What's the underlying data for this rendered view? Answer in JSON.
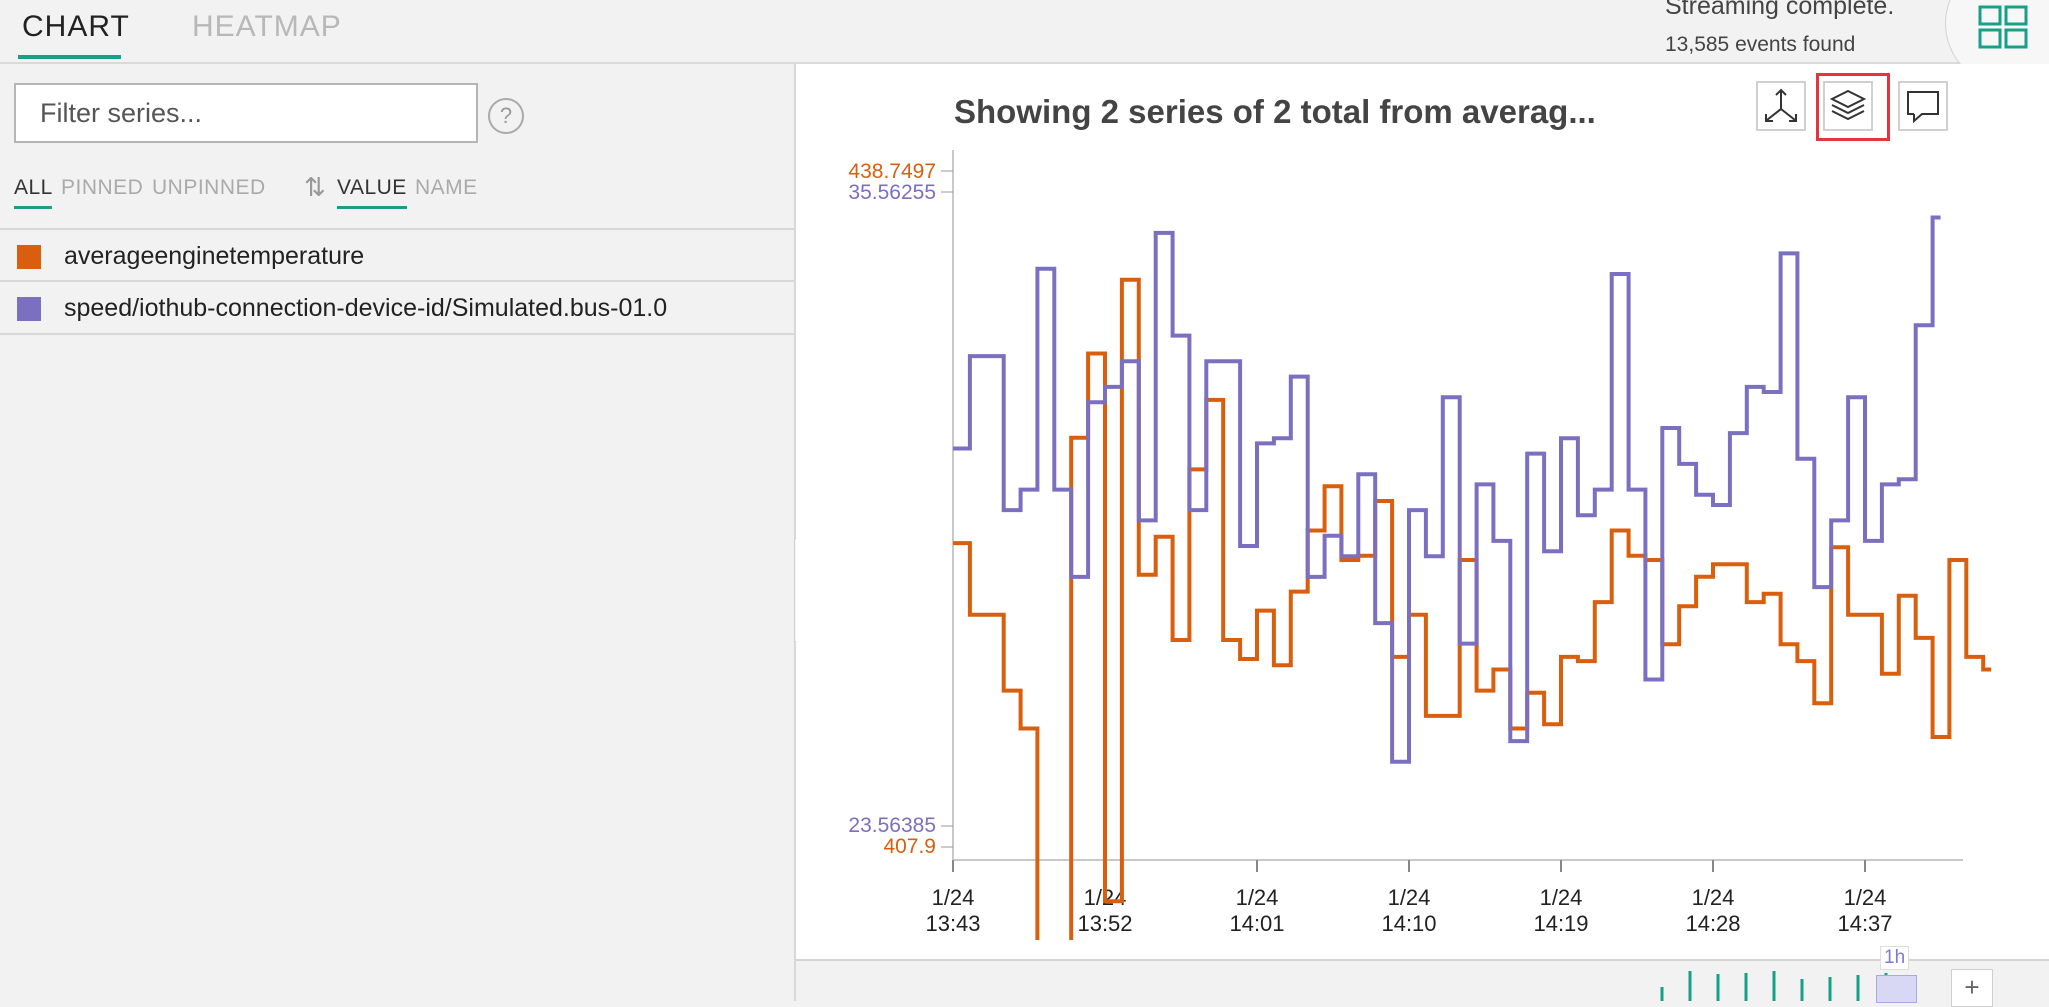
{
  "tabs": [
    {
      "label": "CHART",
      "active": true
    },
    {
      "label": "HEATMAP",
      "active": false
    }
  ],
  "status": {
    "title": "Streaming complete.",
    "count": "13,585 events found"
  },
  "filter": {
    "placeholder": "Filter series...",
    "value": "",
    "help_label": "?"
  },
  "segments": {
    "all": "ALL",
    "pinned": "PINNED",
    "unpinned": "UNPINNED",
    "value": "VALUE",
    "name": "NAME"
  },
  "series_list": [
    {
      "name": "averageenginetemperature",
      "color": "#d95f0e"
    },
    {
      "name": "speed/iothub-connection-device-id/Simulated.bus-01.0",
      "color": "#7b6fbf"
    }
  ],
  "chart": {
    "title": "Showing 2 series of 2 total from averag...",
    "tools": [
      "axes-icon",
      "layers-icon",
      "comment-icon"
    ],
    "highlighted_tool": "layers-icon"
  },
  "chart_data": {
    "type": "line",
    "interpolation": "step",
    "grid": false,
    "x_ticks": [
      {
        "date": "1/24",
        "time": "13:43"
      },
      {
        "date": "1/24",
        "time": "13:52"
      },
      {
        "date": "1/24",
        "time": "14:01"
      },
      {
        "date": "1/24",
        "time": "14:10"
      },
      {
        "date": "1/24",
        "time": "14:19"
      },
      {
        "date": "1/24",
        "time": "14:28"
      },
      {
        "date": "1/24",
        "time": "14:37"
      }
    ],
    "x_range": [
      "13:43",
      "14:45"
    ],
    "series": [
      {
        "name": "averageenginetemperature",
        "color": "#d95f0e",
        "ylim": [
          407.9,
          438.7497
        ],
        "ylim_labels": [
          "407.9",
          "438.7497"
        ],
        "x": [
          "13:43:00",
          "13:44:00",
          "13:46:00",
          "13:47:00",
          "13:48:00",
          "13:50:00",
          "13:51:00",
          "13:52:00",
          "13:53:00",
          "13:54:00",
          "13:55:00",
          "13:56:00",
          "13:57:00",
          "13:58:00",
          "13:59:00",
          "14:00:00",
          "14:01:00",
          "14:02:00",
          "14:03:00",
          "14:04:00",
          "14:05:00",
          "14:06:00",
          "14:07:00",
          "14:08:00",
          "14:09:00",
          "14:10:00",
          "14:11:00",
          "14:13:00",
          "14:14:00",
          "14:15:00",
          "14:16:00",
          "14:17:00",
          "14:18:00",
          "14:19:00",
          "14:20:00",
          "14:21:00",
          "14:22:00",
          "14:23:00",
          "14:24:00",
          "14:25:00",
          "14:26:00",
          "14:27:00",
          "14:28:00",
          "14:30:00",
          "14:31:00",
          "14:32:00",
          "14:33:00",
          "14:34:00",
          "14:35:00",
          "14:36:00",
          "14:38:00",
          "14:39:00",
          "14:40:00",
          "14:41:00",
          "14:42:00",
          "14:43:00",
          "14:44:00"
        ],
        "y": [
          421.8,
          418.4,
          414.8,
          413.0,
          402.4,
          426.8,
          430.8,
          404.8,
          434.3,
          420.3,
          422.1,
          417.2,
          425.3,
          428.6,
          417.2,
          416.3,
          418.6,
          416.0,
          419.5,
          422.4,
          424.5,
          421.0,
          421.2,
          423.8,
          416.4,
          418.4,
          413.6,
          421.0,
          414.8,
          415.8,
          413.0,
          414.7,
          413.2,
          416.4,
          416.2,
          419.0,
          422.4,
          421.2,
          421.0,
          417.0,
          418.8,
          420.2,
          420.8,
          419.0,
          419.4,
          417.0,
          416.2,
          414.2,
          421.6,
          418.4,
          415.6,
          419.3,
          417.3,
          412.6,
          421.0,
          416.4,
          415.8
        ]
      },
      {
        "name": "speed/iothub-connection-device-id/Simulated.bus-01.0",
        "color": "#7b6fbf",
        "ylim": [
          23.56385,
          35.56255
        ],
        "ylim_labels": [
          "23.56385",
          "35.56255"
        ],
        "x": [
          "13:43:00",
          "13:44:00",
          "13:46:00",
          "13:47:00",
          "13:48:00",
          "13:49:00",
          "13:50:00",
          "13:51:00",
          "13:52:00",
          "13:53:00",
          "13:54:00",
          "13:55:00",
          "13:56:00",
          "13:57:00",
          "13:58:00",
          "14:00:00",
          "14:01:00",
          "14:02:00",
          "14:03:00",
          "14:04:00",
          "14:05:00",
          "14:06:00",
          "14:07:00",
          "14:08:00",
          "14:09:00",
          "14:10:00",
          "14:11:00",
          "14:12:00",
          "14:13:00",
          "14:14:00",
          "14:15:00",
          "14:16:00",
          "14:17:00",
          "14:18:00",
          "14:19:00",
          "14:20:00",
          "14:21:00",
          "14:22:00",
          "14:23:00",
          "14:24:00",
          "14:25:00",
          "14:26:00",
          "14:27:00",
          "14:28:00",
          "14:29:00",
          "14:30:00",
          "14:31:00",
          "14:32:00",
          "14:33:00",
          "14:34:00",
          "14:35:00",
          "14:36:00",
          "14:37:00",
          "14:38:00",
          "14:39:00",
          "14:40:00",
          "14:41:00"
        ],
        "y": [
          30.8,
          32.6,
          29.6,
          30.0,
          34.3,
          30.0,
          28.3,
          31.7,
          32.0,
          32.5,
          29.4,
          35.0,
          33.0,
          29.6,
          32.5,
          28.9,
          30.9,
          31.0,
          32.2,
          28.3,
          29.1,
          28.7,
          30.3,
          27.4,
          24.7,
          29.6,
          28.7,
          31.8,
          27.0,
          30.1,
          29.0,
          25.1,
          30.7,
          28.8,
          31.0,
          29.5,
          30.0,
          34.2,
          30.0,
          26.3,
          31.2,
          30.5,
          29.9,
          29.7,
          31.1,
          32.0,
          31.9,
          34.6,
          30.6,
          28.1,
          29.4,
          31.8,
          29.0,
          30.1,
          30.2,
          33.2,
          35.3
        ]
      }
    ]
  },
  "brush": {
    "window_label": "1h",
    "plus_label": "+"
  }
}
